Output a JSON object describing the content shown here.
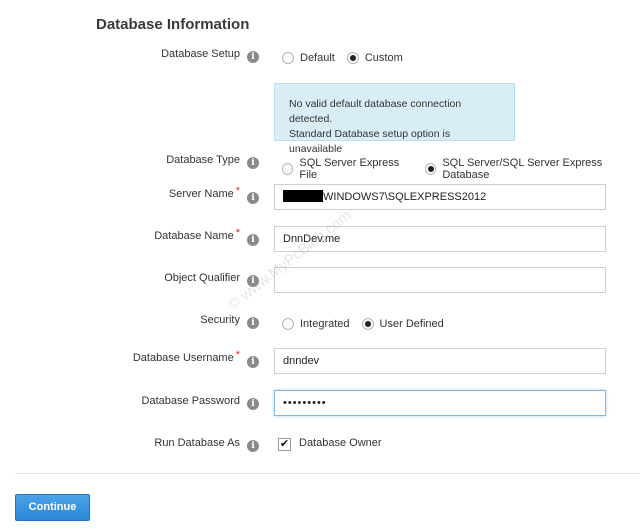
{
  "section_title": "Database Information",
  "fields": {
    "database_setup": {
      "label": "Database Setup",
      "options": [
        "Default",
        "Custom"
      ],
      "selected": "Custom"
    },
    "notice": {
      "line1": "No valid default database connection detected.",
      "line2": "Standard Database setup option is unavailable"
    },
    "database_type": {
      "label": "Database Type",
      "options": [
        "SQL Server Express File",
        "SQL Server/SQL Server Express Database"
      ],
      "selected": "SQL Server/SQL Server Express Database"
    },
    "server_name": {
      "label": "Server Name",
      "required_mark": "*",
      "value": "WINDOWS7\\SQLEXPRESS2012"
    },
    "database_name": {
      "label": "Database Name",
      "required_mark": "*",
      "value": "DnnDev.me"
    },
    "object_qualifier": {
      "label": "Object Qualifier",
      "value": ""
    },
    "security": {
      "label": "Security",
      "options": [
        "Integrated",
        "User Defined"
      ],
      "selected": "User Defined"
    },
    "database_username": {
      "label": "Database Username",
      "required_mark": "*",
      "value": "dnndev"
    },
    "database_password": {
      "label": "Database Password",
      "value": "•••••••••"
    },
    "run_database_as": {
      "label": "Run Database As",
      "checkbox_label": "Database Owner",
      "checked": true
    }
  },
  "icons": {
    "info": "info-icon",
    "check": "checkmark-icon"
  },
  "info_glyph": "i",
  "check_glyph": "✔",
  "continue_button": "Continue",
  "watermark": "© www.MyPcBlog.com",
  "colors": {
    "primary_button": "#2b86d6",
    "notice_bg": "#d9edf7",
    "required": "#d9302c"
  }
}
